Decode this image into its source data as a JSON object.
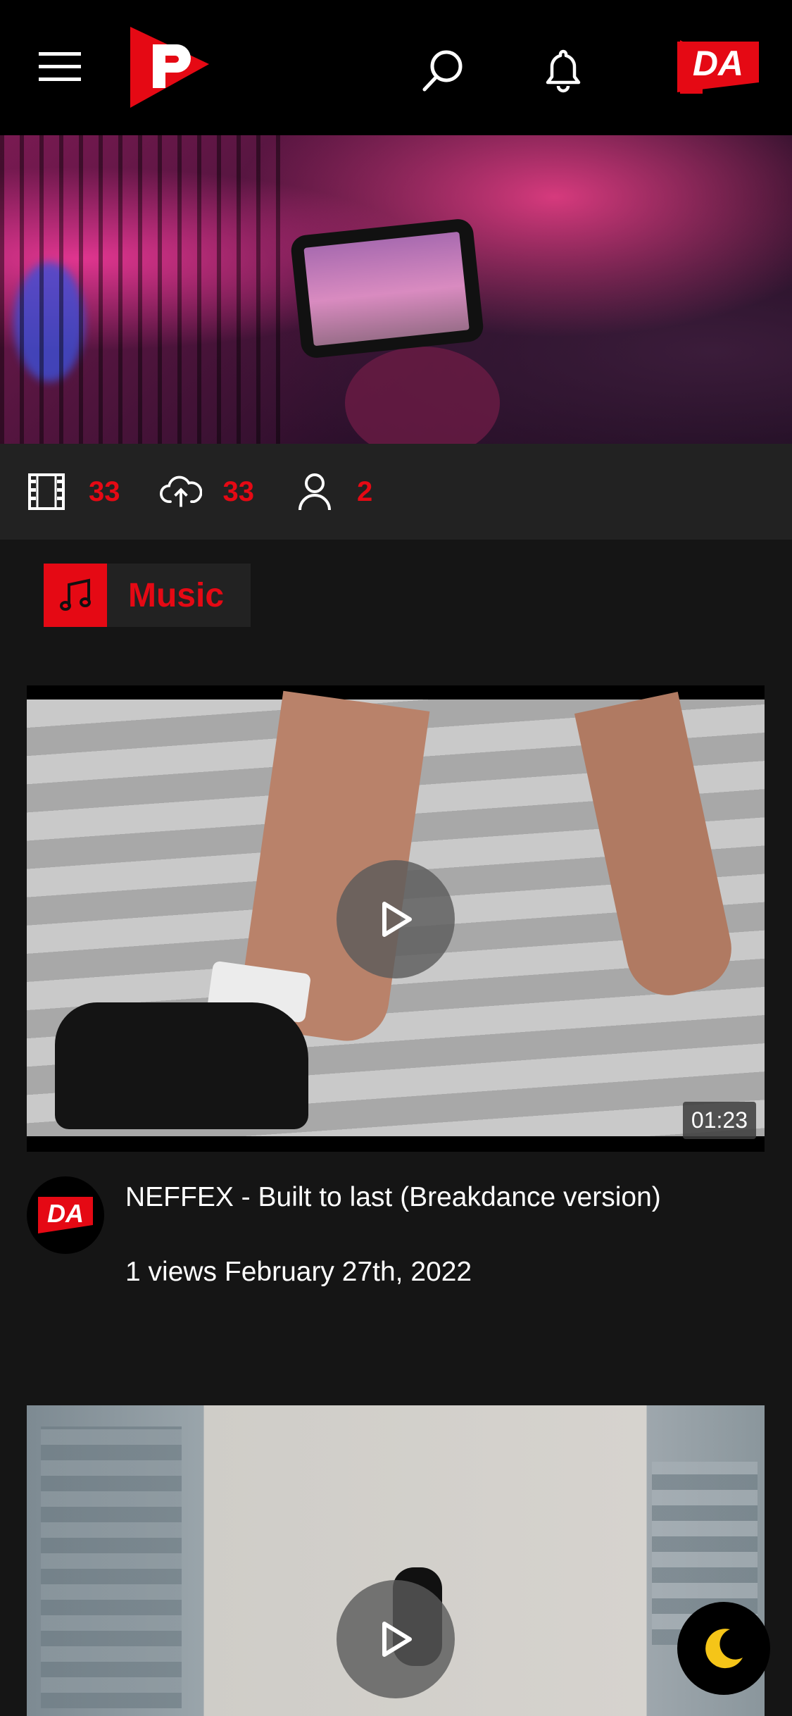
{
  "header": {
    "menu_icon": "hamburger-menu-icon",
    "logo_icon": "p-logo-icon",
    "search_icon": "search-icon",
    "notifications_icon": "bell-icon",
    "avatar_text": "DA"
  },
  "stats": {
    "videos": {
      "icon": "film-icon",
      "count": "33"
    },
    "uploads": {
      "icon": "cloud-upload-icon",
      "count": "33"
    },
    "subscribers": {
      "icon": "user-icon",
      "count": "2"
    }
  },
  "category": {
    "icon": "music-note-icon",
    "label": "Music"
  },
  "videos": [
    {
      "duration": "01:23",
      "channel_avatar_text": "DA",
      "title": "NEFFEX - Built to last (Breakdance version)",
      "meta": "1 views February 27th, 2022"
    }
  ],
  "theme_toggle_icon": "moon-icon",
  "colors": {
    "accent": "#e50914",
    "background": "#151515",
    "bar": "#000000",
    "moon": "#f5c518"
  }
}
